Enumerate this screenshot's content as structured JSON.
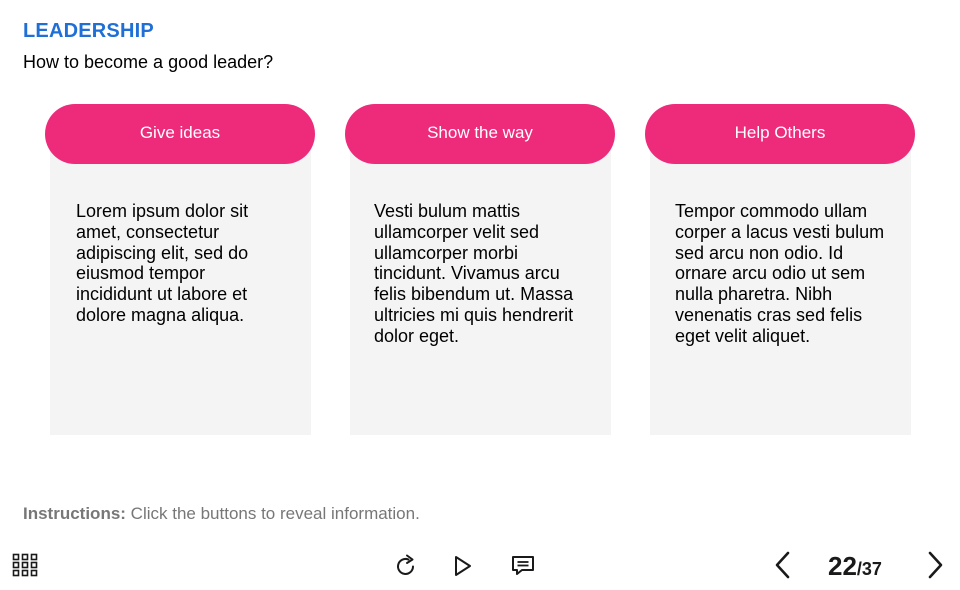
{
  "header": {
    "title": "LEADERSHIP",
    "subtitle": "How to become a good leader?"
  },
  "cards": [
    {
      "button_label": "Give ideas",
      "text": "Lorem ipsum dolor sit amet, consectetur adipiscing elit, sed do eiusmod tempor incididunt ut labore et dolore magna aliqua."
    },
    {
      "button_label": "Show the way",
      "text": "Vesti bulum mattis ullamcorper velit sed ullamcorper morbi tincidunt. Vivamus arcu felis bibendum ut. Massa ultricies mi quis hendrerit dolor eget."
    },
    {
      "button_label": "Help Others",
      "text": "Tempor commodo ullam corper a lacus vesti bulum sed arcu non odio. Id ornare arcu odio ut sem nulla pharetra. Nibh venenatis cras sed felis eget velit aliquet."
    }
  ],
  "instructions": {
    "label": "Instructions:",
    "text": " Click the buttons to reveal information."
  },
  "player": {
    "menu_icon": "grid-menu-icon",
    "replay_icon": "replay-icon",
    "play_icon": "play-icon",
    "captions_icon": "captions-icon",
    "prev_icon": "chevron-left-icon",
    "next_icon": "chevron-right-icon",
    "page_current": "22",
    "page_total": "/37"
  },
  "colors": {
    "title": "#1f6fd6",
    "button": "#ee2a7b",
    "card_background": "#f4f4f4",
    "instructions": "#777777"
  }
}
